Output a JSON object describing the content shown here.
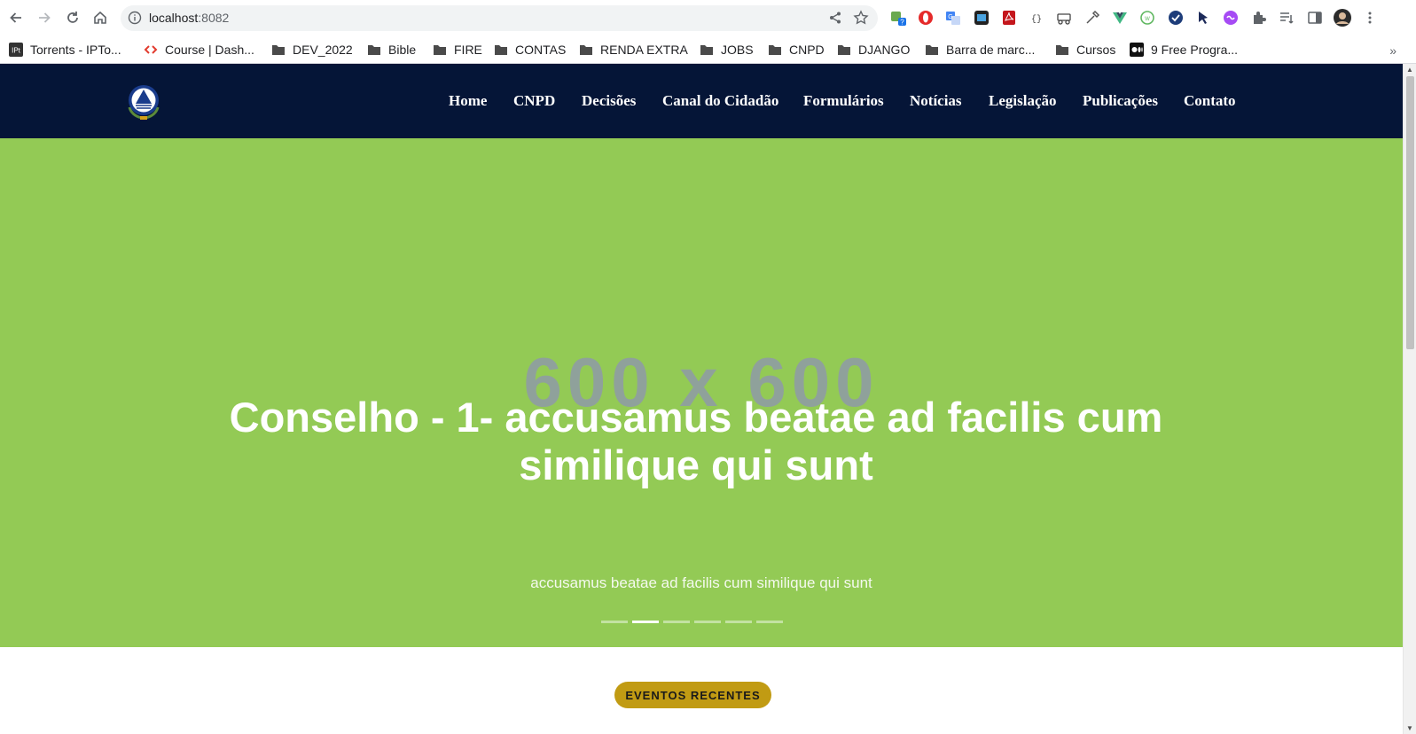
{
  "browser": {
    "url_host": "localhost",
    "url_port": ":8082",
    "icons": {
      "back": "arrow-left-icon",
      "forward": "arrow-right-icon",
      "reload": "reload-icon",
      "home": "home-icon"
    }
  },
  "bookmarks": [
    {
      "label": "Torrents - IPTo...",
      "icon": "iptorrents-favicon"
    },
    {
      "label": "Course | Dash...",
      "icon": "course-favicon"
    },
    {
      "label": "DEV_2022",
      "icon": "folder-icon"
    },
    {
      "label": "Bible",
      "icon": "folder-icon"
    },
    {
      "label": "FIRE",
      "icon": "folder-icon"
    },
    {
      "label": "CONTAS",
      "icon": "folder-icon"
    },
    {
      "label": "RENDA EXTRA",
      "icon": "folder-icon"
    },
    {
      "label": "JOBS",
      "icon": "folder-icon"
    },
    {
      "label": "CNPD",
      "icon": "folder-icon"
    },
    {
      "label": "DJANGO",
      "icon": "folder-icon"
    },
    {
      "label": "Barra de marc...",
      "icon": "folder-icon"
    },
    {
      "label": "Cursos",
      "icon": "folder-icon"
    },
    {
      "label": "9 Free Progra...",
      "icon": "medium-favicon"
    }
  ],
  "bookmarks_more": "»",
  "site": {
    "menu": [
      "Home",
      "CNPD",
      "Decisões",
      "Canal do Cidadão",
      "Formulários",
      "Notícias",
      "Legislação",
      "Publicações",
      "Contato"
    ],
    "hero": {
      "placeholder": "600 x 600",
      "title": "Conselho - 1- accusamus beatae ad facilis cum similique qui sunt",
      "subtitle": "accusamus beatae ad facilis cum similique qui sunt",
      "slides": 6,
      "active_slide": 2,
      "background": "#93ca55"
    },
    "events_button": "EVENTOS RECENTES",
    "colors": {
      "nav_bg": "#051537",
      "accent": "#c19b13"
    }
  }
}
